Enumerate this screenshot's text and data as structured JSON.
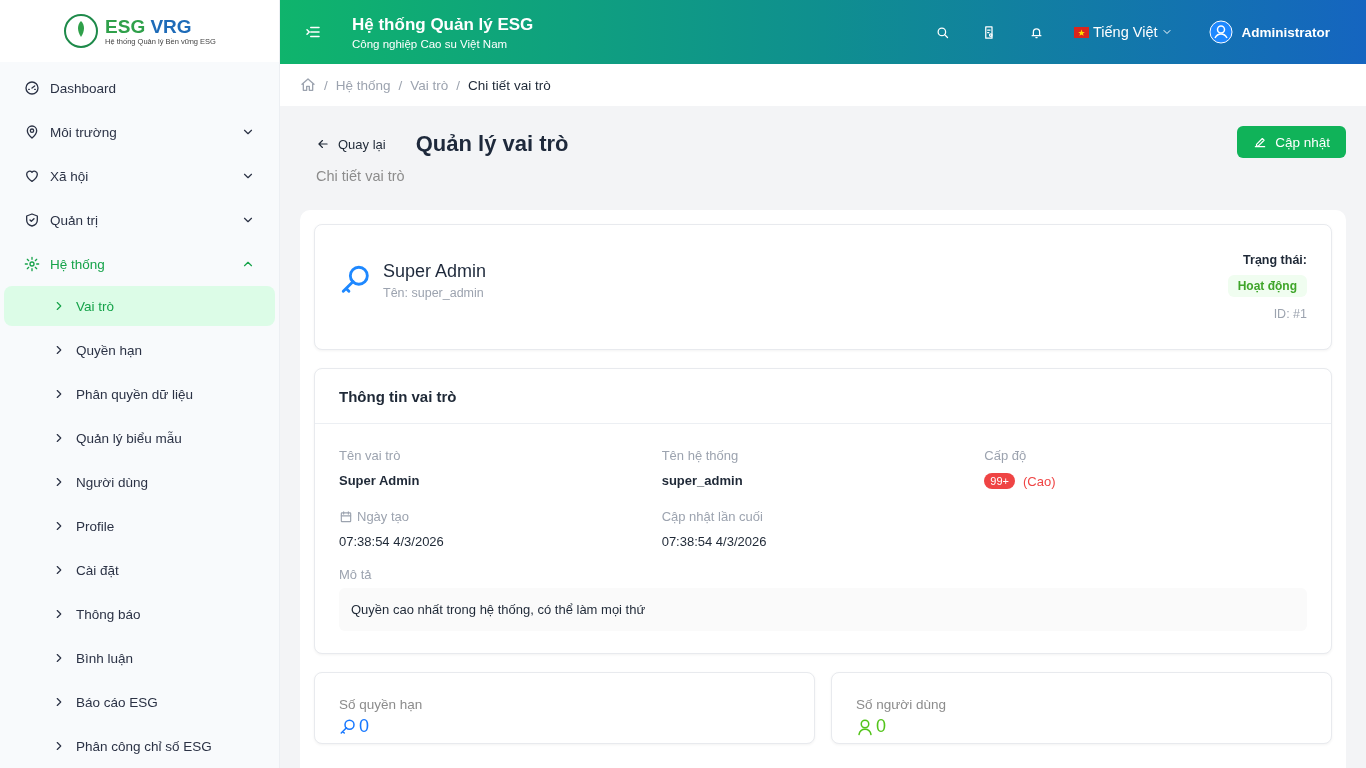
{
  "logo": {
    "title_a": "ESG",
    "title_b": "VRG",
    "subtitle": "Hệ thống Quản lý Bền vững ESG"
  },
  "sidebar": {
    "items": [
      {
        "label": "Dashboard",
        "active": false
      },
      {
        "label": "Môi trường",
        "active": false,
        "expanded": false
      },
      {
        "label": "Xã hội",
        "active": false,
        "expanded": false
      },
      {
        "label": "Quản trị",
        "active": false,
        "expanded": false
      },
      {
        "label": "Hệ thống",
        "active": true,
        "expanded": true,
        "children": [
          {
            "label": "Vai trò",
            "selected": true
          },
          {
            "label": "Quyền hạn",
            "selected": false
          },
          {
            "label": "Phân quyền dữ liệu",
            "selected": false
          },
          {
            "label": "Quản lý biểu mẫu",
            "selected": false
          },
          {
            "label": "Người dùng",
            "selected": false
          },
          {
            "label": "Profile",
            "selected": false
          },
          {
            "label": "Cài đặt",
            "selected": false
          },
          {
            "label": "Thông báo",
            "selected": false
          },
          {
            "label": "Bình luận",
            "selected": false
          },
          {
            "label": "Báo cáo ESG",
            "selected": false
          },
          {
            "label": "Phân công chỉ số ESG",
            "selected": false
          }
        ]
      }
    ]
  },
  "header": {
    "title": "Hệ thống Quản lý ESG",
    "subtitle": "Công nghiệp Cao su Việt Nam",
    "language": "Tiếng Việt",
    "user": "Administrator"
  },
  "breadcrumb": {
    "separator": "/",
    "items": [
      "Hệ thống",
      "Vai trò",
      "Chi tiết vai trò"
    ]
  },
  "page": {
    "back": "Quay lại",
    "title": "Quản lý vai trò",
    "subtitle": "Chi tiết vai trò",
    "update_button": "Cập nhật"
  },
  "role": {
    "name": "Super Admin",
    "code": "Tên: super_admin",
    "status_label": "Trạng thái:",
    "status": "Hoạt động",
    "id": "ID: #1"
  },
  "info": {
    "title": "Thông tin vai trò",
    "fields": [
      {
        "label": "Tên vai trò",
        "value": "Super Admin",
        "kind": "bold"
      },
      {
        "label": "Tên hệ thống",
        "value": "super_admin",
        "kind": "bold"
      },
      {
        "label": "Cấp độ",
        "badge": "99+",
        "value": "(Cao)",
        "kind": "level"
      },
      {
        "label": "Ngày tạo",
        "value": "07:38:54 4/3/2026",
        "kind": "date"
      },
      {
        "label": "Cập nhật lần cuối",
        "value": "07:38:54 4/3/2026",
        "kind": "plain"
      }
    ],
    "description_label": "Mô tả",
    "description": "Quyền cao nhất trong hệ thống, có thể làm mọi thứ"
  },
  "stats": [
    {
      "label": "Số quyền hạn",
      "value": "0",
      "color": "#1677ff"
    },
    {
      "label": "Số người dùng",
      "value": "0",
      "color": "#52c41a"
    }
  ]
}
